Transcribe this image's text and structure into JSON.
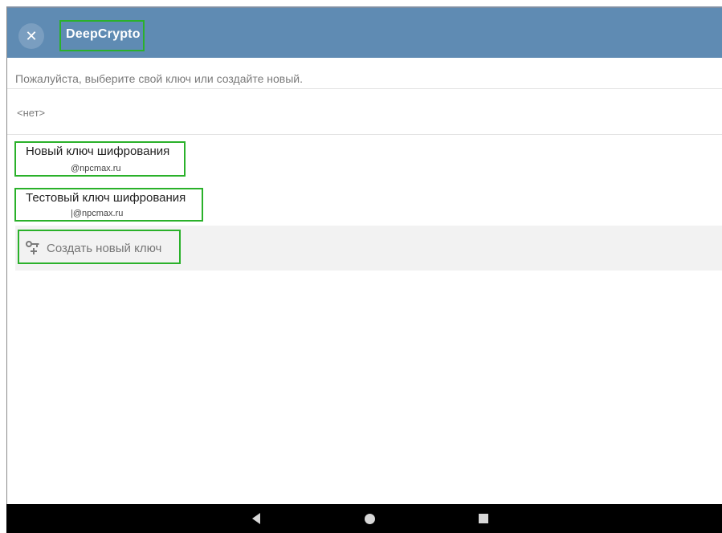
{
  "app_bar": {
    "close_icon": "close-icon",
    "close_glyph": "✕",
    "title": "DeepCrypto",
    "color": "#5f8bb3"
  },
  "prompt": "Пожалуйста, выберите свой ключ или создайте новый.",
  "none_item": "<нет>",
  "keys": [
    {
      "name": "Новый ключ шифрования",
      "email": "@npcmax.ru"
    },
    {
      "name": "Тестовый ключ шифрования",
      "email": "|@npcmax.ru"
    }
  ],
  "create_key": {
    "icon": "key-add-icon",
    "label": "Создать новый ключ"
  },
  "nav": {
    "back_icon": "back-triangle-icon",
    "home_icon": "home-circle-icon",
    "recents_icon": "recents-square-icon"
  },
  "colors": {
    "highlight": "#2ab12a",
    "navbar": "#000000"
  }
}
